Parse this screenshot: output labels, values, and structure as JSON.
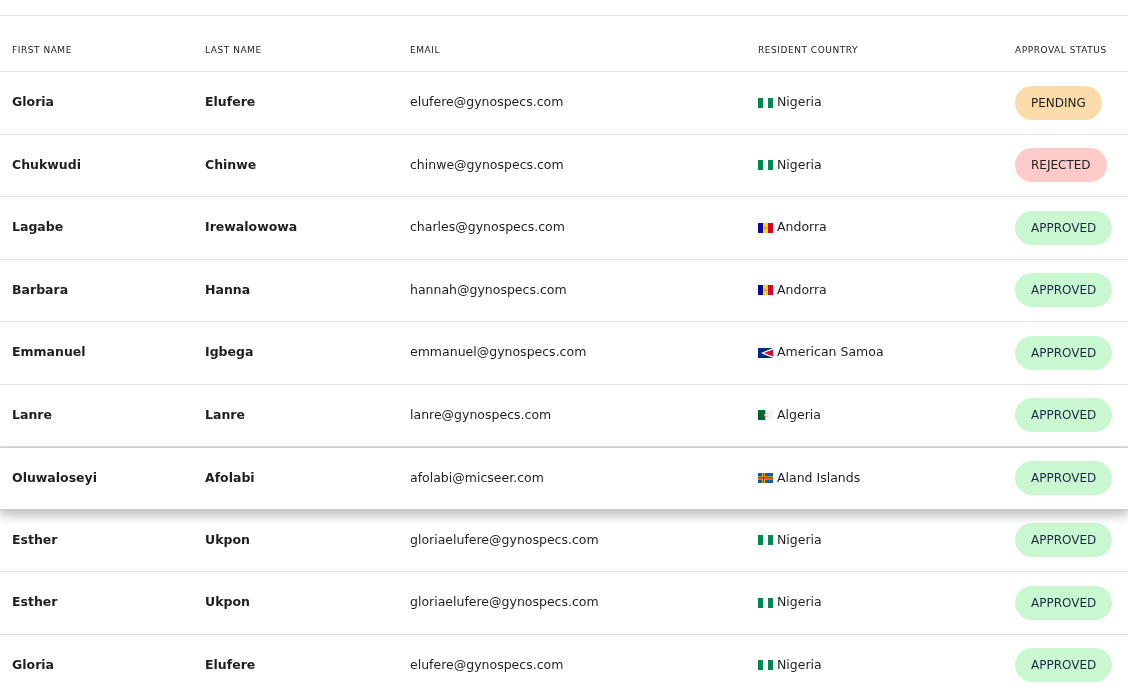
{
  "table": {
    "columns": [
      "FIRST NAME",
      "LAST NAME",
      "EMAIL",
      "RESIDENT COUNTRY",
      "APPROVAL STATUS"
    ],
    "rows": [
      {
        "first_name": "Gloria",
        "last_name": "Elufere",
        "email": "elufere@gynospecs.com",
        "country": {
          "kind": "ng",
          "name": "Nigeria"
        },
        "status": {
          "kind": "pending",
          "label": "PENDING"
        },
        "hovered": false
      },
      {
        "first_name": "Chukwudi",
        "last_name": "Chinwe",
        "email": "chinwe@gynospecs.com",
        "country": {
          "kind": "ng",
          "name": "Nigeria"
        },
        "status": {
          "kind": "rejected",
          "label": "REJECTED"
        },
        "hovered": false
      },
      {
        "first_name": "Lagabe",
        "last_name": "Irewalowowa",
        "email": "charles@gynospecs.com",
        "country": {
          "kind": "ad",
          "name": "Andorra"
        },
        "status": {
          "kind": "approved",
          "label": "APPROVED"
        },
        "hovered": false
      },
      {
        "first_name": "Barbara",
        "last_name": "Hanna",
        "email": "hannah@gynospecs.com",
        "country": {
          "kind": "ad",
          "name": "Andorra"
        },
        "status": {
          "kind": "approved",
          "label": "APPROVED"
        },
        "hovered": false
      },
      {
        "first_name": "Emmanuel",
        "last_name": "Igbega",
        "email": "emmanuel@gynospecs.com",
        "country": {
          "kind": "as",
          "name": "American Samoa"
        },
        "status": {
          "kind": "approved",
          "label": "APPROVED"
        },
        "hovered": false
      },
      {
        "first_name": "Lanre",
        "last_name": "Lanre",
        "email": "lanre@gynospecs.com",
        "country": {
          "kind": "dz",
          "name": "Algeria"
        },
        "status": {
          "kind": "approved",
          "label": "APPROVED"
        },
        "hovered": false
      },
      {
        "first_name": "Oluwaloseyi",
        "last_name": "Afolabi",
        "email": "afolabi@micseer.com",
        "country": {
          "kind": "ax",
          "name": "Aland Islands"
        },
        "status": {
          "kind": "approved",
          "label": "APPROVED"
        },
        "hovered": true
      },
      {
        "first_name": "Esther",
        "last_name": "Ukpon",
        "email": "gloriaelufere@gynospecs.com",
        "country": {
          "kind": "ng",
          "name": "Nigeria"
        },
        "status": {
          "kind": "approved",
          "label": "APPROVED"
        },
        "hovered": false
      },
      {
        "first_name": "Esther",
        "last_name": "Ukpon",
        "email": "gloriaelufere@gynospecs.com",
        "country": {
          "kind": "ng",
          "name": "Nigeria"
        },
        "status": {
          "kind": "approved",
          "label": "APPROVED"
        },
        "hovered": false
      },
      {
        "first_name": "Gloria",
        "last_name": "Elufere",
        "email": "elufere@gynospecs.com",
        "country": {
          "kind": "ng",
          "name": "Nigeria"
        },
        "status": {
          "kind": "approved",
          "label": "APPROVED"
        },
        "hovered": false
      }
    ]
  }
}
